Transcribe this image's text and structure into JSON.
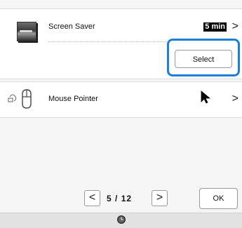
{
  "screen_saver": {
    "label": "Screen Saver",
    "value": "5 min",
    "chevron": ">",
    "select_label": "Select"
  },
  "mouse_pointer": {
    "label": "Mouse Pointer",
    "chevron": ">"
  },
  "pagination": {
    "prev": "<",
    "next": ">",
    "current": "5",
    "separator": "/",
    "total": "12"
  },
  "ok_label": "OK",
  "icons": {
    "screen_saver": "screen-saver-thumbnail-icon",
    "mouse": "mouse-icon",
    "pointer": "arrow-pointer-icon",
    "status": "clock-icon"
  },
  "colors": {
    "highlight": "#1e7fd9",
    "background": "#f5f5f5",
    "card": "#ffffff"
  }
}
